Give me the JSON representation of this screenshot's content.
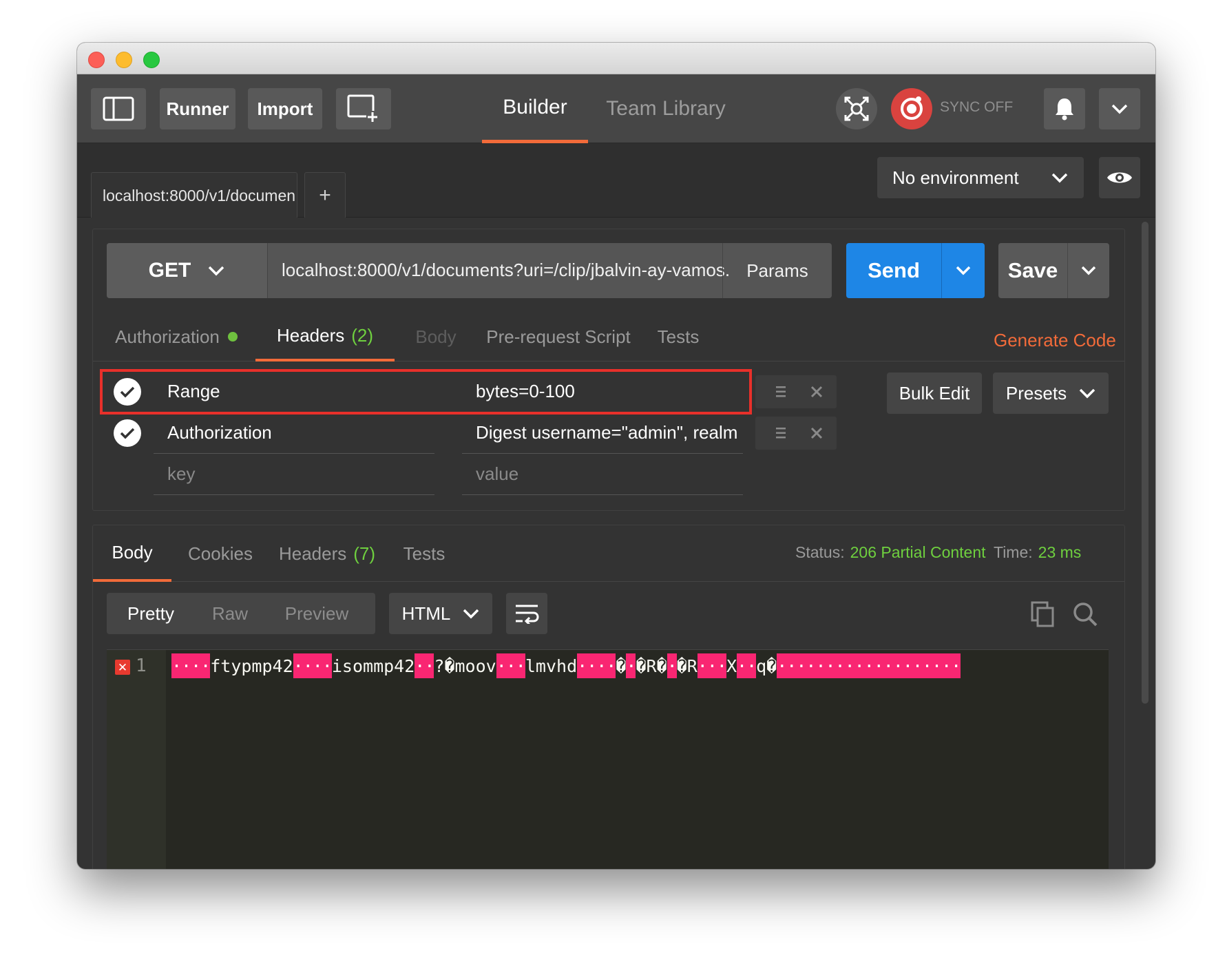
{
  "toolbar": {
    "runner_label": "Runner",
    "import_label": "Import",
    "nav_builder": "Builder",
    "nav_team_library": "Team Library",
    "sync_label": "SYNC OFF"
  },
  "tabs": {
    "request_tab_label": "localhost:8000/v1/documen",
    "add_tab_label": "+"
  },
  "environment": {
    "selected": "No environment"
  },
  "request": {
    "method": "GET",
    "url": "localhost:8000/v1/documents?uri=/clip/jbalvin-ay-vamos.",
    "params_label": "Params",
    "send_label": "Send",
    "save_label": "Save",
    "generate_code_label": "Generate Code",
    "subtabs": {
      "authorization": "Authorization",
      "headers": "Headers",
      "headers_count": "(2)",
      "body": "Body",
      "pre_request": "Pre-request Script",
      "tests": "Tests"
    },
    "headers": [
      {
        "key": "Range",
        "value": "bytes=0-100"
      },
      {
        "key": "Authorization",
        "value": "Digest username=\"admin\", realm"
      }
    ],
    "new_header": {
      "key_placeholder": "key",
      "value_placeholder": "value"
    },
    "bulk_edit_label": "Bulk Edit",
    "presets_label": "Presets"
  },
  "response": {
    "tabs": {
      "body": "Body",
      "cookies": "Cookies",
      "headers": "Headers",
      "headers_count": "(7)",
      "tests": "Tests"
    },
    "status_label": "Status:",
    "status_value": "206 Partial Content",
    "time_label": "Time:",
    "time_value": "23 ms",
    "view_modes": [
      "Pretty",
      "Raw",
      "Preview"
    ],
    "format": "HTML",
    "error_mark": "✕",
    "line_number": "1",
    "body_segments": [
      {
        "text": "····",
        "ctl": true
      },
      {
        "text": "ftypmp42",
        "ctl": false
      },
      {
        "text": "····",
        "ctl": true
      },
      {
        "text": "isommp42",
        "ctl": false
      },
      {
        "text": "··",
        "ctl": true
      },
      {
        "text": "?�moov",
        "ctl": false
      },
      {
        "text": "···",
        "ctl": true
      },
      {
        "text": "lmvhd",
        "ctl": false
      },
      {
        "text": "····",
        "ctl": true
      },
      {
        "text": "�",
        "ctl": false
      },
      {
        "text": "·",
        "ctl": true
      },
      {
        "text": "�R�",
        "ctl": false
      },
      {
        "text": "·",
        "ctl": true
      },
      {
        "text": "�R",
        "ctl": false
      },
      {
        "text": "···",
        "ctl": true
      },
      {
        "text": "X",
        "ctl": false
      },
      {
        "text": "··",
        "ctl": true
      },
      {
        "text": "q�",
        "ctl": false
      },
      {
        "text": "···················",
        "ctl": true
      }
    ]
  },
  "colors": {
    "accent_orange": "#f26b3a",
    "send_blue": "#1e86e6",
    "status_green": "#6fd03f",
    "highlight_red": "#e8302a",
    "control_char_pink": "#f92672"
  },
  "icons": [
    "sidebar-toggle-icon",
    "new-window-icon",
    "interceptor-icon",
    "sync-icon",
    "bell-icon",
    "chevron-down-icon",
    "eye-icon",
    "check-icon",
    "drag-handle-icon",
    "close-icon",
    "wrap-lines-icon",
    "copy-icon",
    "search-icon"
  ]
}
